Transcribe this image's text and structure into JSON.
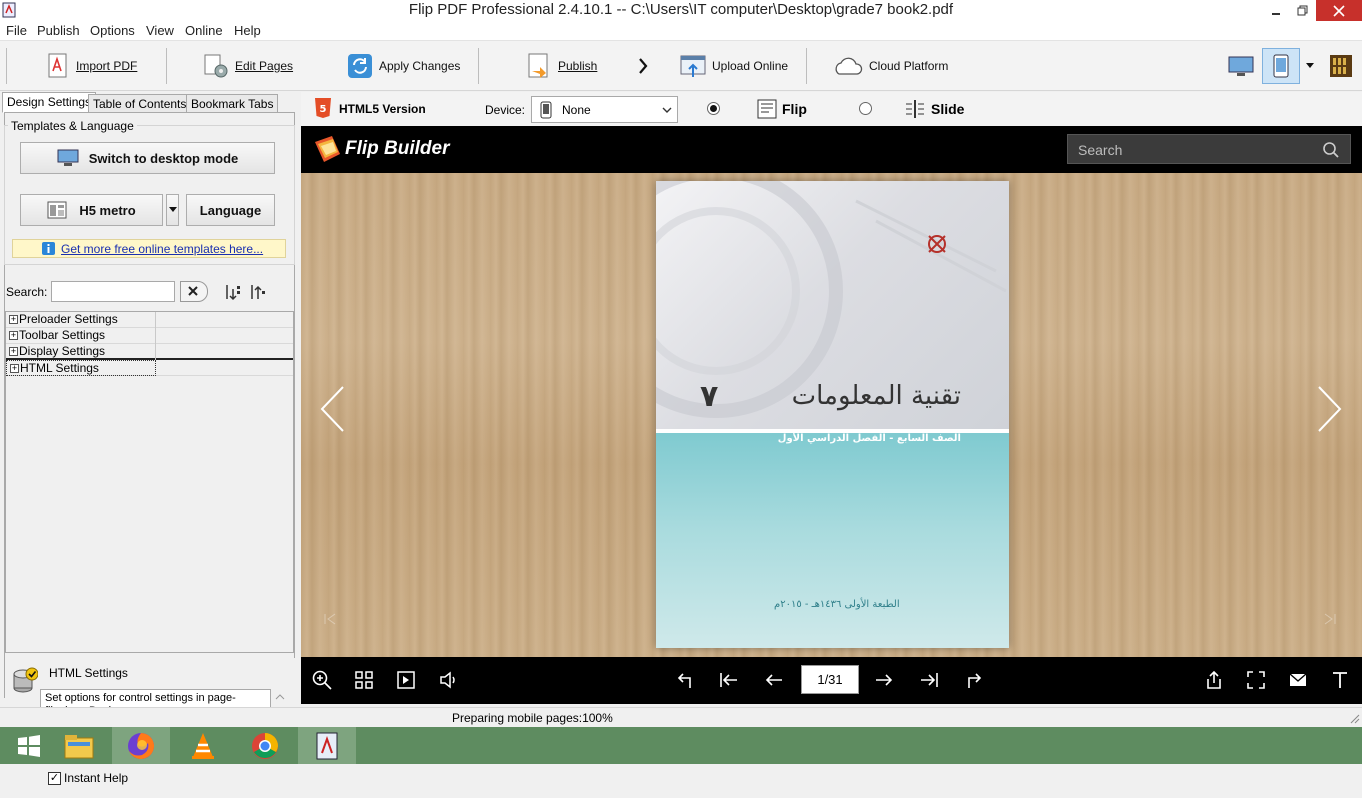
{
  "window": {
    "title": "Flip PDF Professional 2.4.10.1 -- C:\\Users\\IT computer\\Desktop\\grade7 book2.pdf"
  },
  "menu": [
    "File",
    "Publish",
    "Options",
    "View",
    "Online",
    "Help"
  ],
  "toolbar": {
    "import_pdf": "Import PDF",
    "edit_pages": "Edit Pages",
    "apply_changes": "Apply Changes",
    "publish": "Publish",
    "upload_online": "Upload Online",
    "cloud_platform": "Cloud Platform"
  },
  "left_tabs": [
    "Design Settings",
    "Table of Contents",
    "Bookmark Tabs"
  ],
  "templates": {
    "group_label": "Templates & Language",
    "switch_desktop": "Switch to desktop mode",
    "template_name": "H5 metro",
    "language": "Language",
    "link": "Get more free online templates here..."
  },
  "search": {
    "label": "Search:",
    "value": ""
  },
  "settings_tree": [
    "Preloader Settings",
    "Toolbar Settings",
    "Display Settings",
    "HTML Settings"
  ],
  "help": {
    "title": "HTML Settings",
    "text": "Set options for control settings in page-flipping eBooks",
    "instant_help": "Instant Help",
    "instant_help_checked": true
  },
  "options_bar": {
    "version": "HTML5 Version",
    "device_label": "Device:",
    "device_value": "None",
    "flip": "Flip",
    "slide": "Slide",
    "selected_mode": "Flip"
  },
  "viewer": {
    "brand": "Flip Builder",
    "search_placeholder": "Search",
    "page_indicator": "1/31",
    "book": {
      "title": "تقنية المعلومات",
      "grade_number": "٧",
      "subtitle": "الصف السابع - الفصل الدراسي الأول",
      "edition": "الطبعة الأولى ١٤٣٦هـ - ٢٠١٥م"
    }
  },
  "status": {
    "text": "Preparing mobile pages:100%"
  },
  "colors": {
    "close": "#c7302b",
    "taskbar": "#5e8c60",
    "viewer_bg": "#000000",
    "book_teal": "#7fcad0"
  },
  "taskbar_icons": [
    "windows-start-icon",
    "file-explorer-icon",
    "firefox-icon",
    "vlc-icon",
    "chrome-icon",
    "flip-pdf-icon"
  ]
}
